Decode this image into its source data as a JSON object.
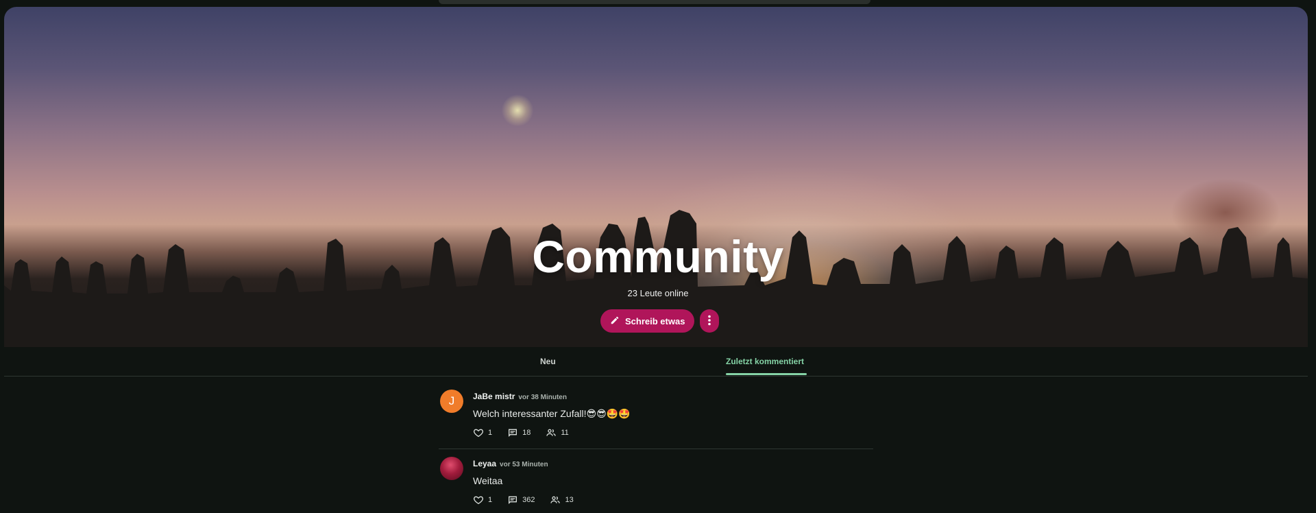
{
  "hero": {
    "title": "Community",
    "online": "23 Leute online",
    "write_button": "Schreib etwas"
  },
  "tabs": [
    {
      "label": "Neu",
      "active": false
    },
    {
      "label": "Zuletzt kommentiert",
      "active": true
    }
  ],
  "posts": [
    {
      "avatar_letter": "J",
      "author": "JaBe mistr",
      "time": "vor 38 Minuten",
      "text": "Welch interessanter Zufall!😎😎🤩🤩",
      "likes": "1",
      "comments": "18",
      "followers": "11"
    },
    {
      "avatar_letter": "",
      "author": "Leyaa",
      "time": "vor 53 Minuten",
      "text": "Weitaa",
      "likes": "1",
      "comments": "362",
      "followers": "13"
    }
  ],
  "colors": {
    "accent": "#b0155a",
    "tab_active": "#85d3a6",
    "background": "#0f1411"
  },
  "icons": [
    "pencil-icon",
    "more-vertical-icon",
    "heart-icon",
    "comment-icon",
    "people-icon"
  ]
}
